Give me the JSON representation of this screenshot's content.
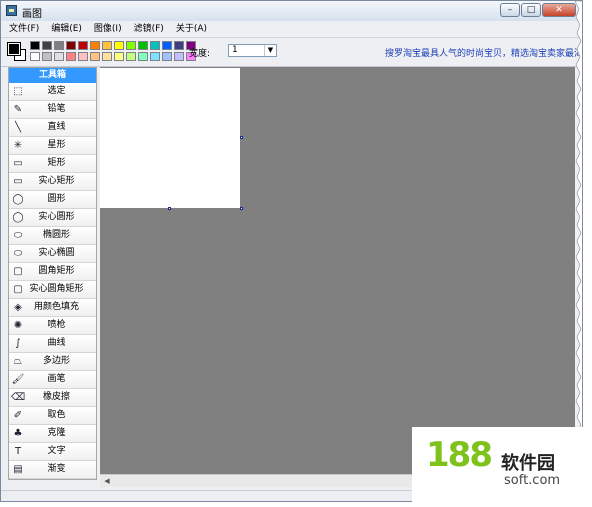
{
  "window": {
    "title": "画图",
    "buttons": {
      "minimize": "–",
      "maximize": "□",
      "close": "✕"
    }
  },
  "menu": [
    {
      "label": "文件(F)"
    },
    {
      "label": "编辑(E)"
    },
    {
      "label": "图像(I)"
    },
    {
      "label": "滤镜(F)"
    },
    {
      "label": "关于(A)"
    }
  ],
  "toolbar": {
    "palette": [
      "#000000",
      "#404040",
      "#808080",
      "#800000",
      "#c00000",
      "#ff8000",
      "#ffc040",
      "#ffff00",
      "#80ff00",
      "#00c000",
      "#00c0c0",
      "#0060ff",
      "#404080",
      "#800080",
      "#ffffff",
      "#c0c0c0",
      "#e0e0e0",
      "#ff8080",
      "#ffc0c0",
      "#ffc080",
      "#ffe0a0",
      "#ffff80",
      "#c0ff80",
      "#80ffc0",
      "#80e0ff",
      "#a0c0ff",
      "#c0c0ff",
      "#ff80ff"
    ],
    "width_label": "宽度:",
    "width_value": "1",
    "ad_text": "搜罗淘宝最具人气的时尚宝贝，精选淘宝卖家最渴望的"
  },
  "toolbox": {
    "header": "工具箱",
    "tools": [
      {
        "label": "选定",
        "icon": "select-icon",
        "glyph": "⬚"
      },
      {
        "label": "铅笔",
        "icon": "pencil-icon",
        "glyph": "✎"
      },
      {
        "label": "直线",
        "icon": "line-icon",
        "glyph": "╲"
      },
      {
        "label": "星形",
        "icon": "star-icon",
        "glyph": "✳"
      },
      {
        "label": "矩形",
        "icon": "rectangle-icon",
        "glyph": "▭"
      },
      {
        "label": "实心矩形",
        "icon": "filled-rectangle-icon",
        "glyph": "▭"
      },
      {
        "label": "圆形",
        "icon": "circle-icon",
        "glyph": "◯"
      },
      {
        "label": "实心圆形",
        "icon": "filled-circle-icon",
        "glyph": "◯"
      },
      {
        "label": "椭圆形",
        "icon": "ellipse-icon",
        "glyph": "⬭"
      },
      {
        "label": "实心椭圆",
        "icon": "filled-ellipse-icon",
        "glyph": "⬭"
      },
      {
        "label": "圆角矩形",
        "icon": "rounded-rectangle-icon",
        "glyph": "▢"
      },
      {
        "label": "实心圆角矩形",
        "icon": "filled-rounded-rectangle-icon",
        "glyph": "▢"
      },
      {
        "label": "用颜色填充",
        "icon": "fill-bucket-icon",
        "glyph": "◈"
      },
      {
        "label": "喷枪",
        "icon": "airbrush-icon",
        "glyph": "✺"
      },
      {
        "label": "曲线",
        "icon": "curve-icon",
        "glyph": "∫"
      },
      {
        "label": "多边形",
        "icon": "polygon-icon",
        "glyph": "⏢"
      },
      {
        "label": "画笔",
        "icon": "brush-icon",
        "glyph": "🖌"
      },
      {
        "label": "橡皮擦",
        "icon": "eraser-icon",
        "glyph": "⌫"
      },
      {
        "label": "取色",
        "icon": "color-picker-icon",
        "glyph": "✐"
      },
      {
        "label": "克隆",
        "icon": "clone-stamp-icon",
        "glyph": "♣"
      },
      {
        "label": "文字",
        "icon": "text-icon",
        "glyph": "T"
      },
      {
        "label": "渐变",
        "icon": "gradient-icon",
        "glyph": "▤"
      }
    ]
  },
  "watermark": {
    "logo": "188",
    "brand": "软件园",
    "url": "soft.com"
  }
}
